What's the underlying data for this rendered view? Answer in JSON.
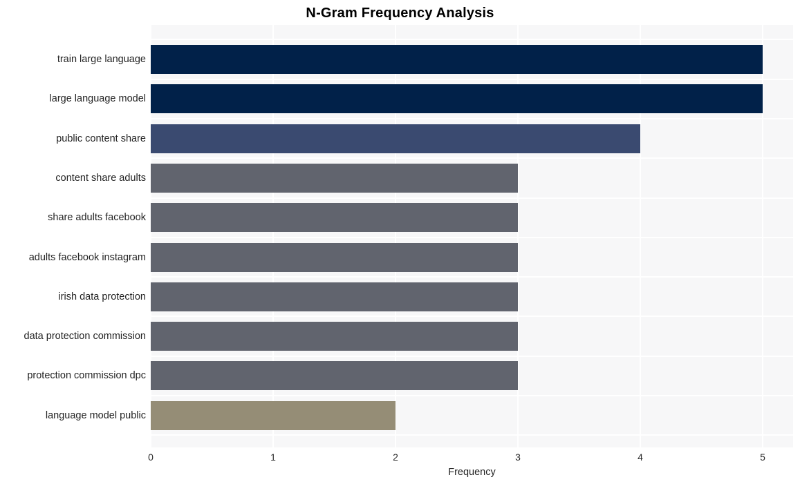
{
  "chart_data": {
    "type": "bar",
    "orientation": "horizontal",
    "title": "N-Gram Frequency Analysis",
    "xlabel": "Frequency",
    "ylabel": "",
    "xlim": [
      0,
      5
    ],
    "xticks": [
      "0",
      "1",
      "2",
      "3",
      "4",
      "5"
    ],
    "grid": true,
    "legend": "none",
    "categories": [
      "train large language",
      "large language model",
      "public content share",
      "content share adults",
      "share adults facebook",
      "adults facebook instagram",
      "irish data protection",
      "data protection commission",
      "protection commission dpc",
      "language model public"
    ],
    "values": [
      5,
      5,
      4,
      3,
      3,
      3,
      3,
      3,
      3,
      2
    ],
    "bar_colors": [
      "#012149",
      "#012149",
      "#3a4a70",
      "#61646e",
      "#61646e",
      "#61646e",
      "#61646e",
      "#61646e",
      "#61646e",
      "#958d76"
    ]
  },
  "style": {
    "plot_background": "#f7f7f8",
    "figure_background": "#ffffff",
    "gridline_color": "#ffffff",
    "title_color": "#000000",
    "tick_color": "#2b2b2b"
  }
}
